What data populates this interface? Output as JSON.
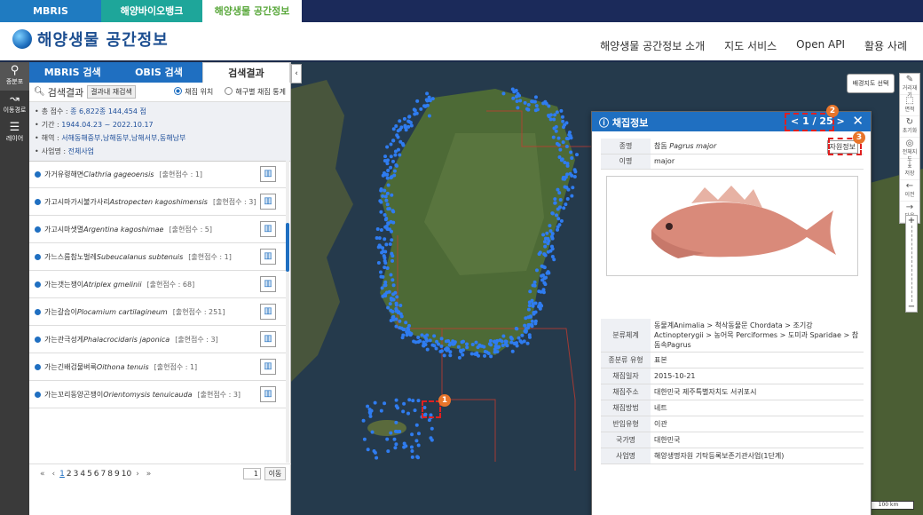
{
  "topnav": {
    "tabs": [
      "MBRIS",
      "해양바이오뱅크",
      "해양생물 공간정보"
    ]
  },
  "header": {
    "logo_text": "해양생물 공간정보",
    "nav": [
      "해양생물 공간정보 소개",
      "지도 서비스",
      "Open API",
      "활용 사례"
    ]
  },
  "rail": {
    "items": [
      {
        "label": "종분포",
        "icon": "map-pin-icon"
      },
      {
        "label": "이동경로",
        "icon": "route-icon"
      },
      {
        "label": "레이어",
        "icon": "layers-icon"
      }
    ]
  },
  "panel": {
    "tabs": [
      "MBRIS 검색",
      "OBIS 검색",
      "검색결과"
    ],
    "search_label": "검색결과",
    "research_button": "결과내 재검색",
    "radio_1": "채집 위치",
    "radio_2": "해구별 채집 통계",
    "summary": {
      "total_k": "총 점수 : ",
      "total_v": "종 6,822종 144,454 점",
      "period_k": "기간 : ",
      "period_v": "1944.04.23 ~ 2022.10.17",
      "area_k": "해역 : ",
      "area_v": "서해동해중부,남해동부,남해서부,동해남부",
      "project_k": "사업명 : ",
      "project_v": "전체사업"
    },
    "results": [
      {
        "ko": "가거유령해면",
        "sci": "Clathria gageoensis",
        "count": "[출현점수 : 1]"
      },
      {
        "ko": "가고시마가시불가사리",
        "sci": "Astropecten kagoshimensis",
        "count": "[출현점수 : 3]"
      },
      {
        "ko": "가고시마샛멸",
        "sci": "Argentina kagoshimae",
        "count": "[출현점수 : 5]"
      },
      {
        "ko": "가느스름참노벌레",
        "sci": "Subeucalanus subtenuis",
        "count": "[출현점수 : 1]"
      },
      {
        "ko": "가는갯는쟁이",
        "sci": "Atriplex gmelinii",
        "count": "[출현점수 : 68]"
      },
      {
        "ko": "가는갈습이",
        "sci": "Plocamium cartilagineum",
        "count": "[출현점수 : 251]"
      },
      {
        "ko": "가는관극성게",
        "sci": "Phalacrocidaris japonica",
        "count": "[출현점수 : 3]"
      },
      {
        "ko": "가는긴배검물벼룩",
        "sci": "Oithona tenuis",
        "count": "[출현점수 : 1]"
      },
      {
        "ko": "가는꼬리동양곤쟁이",
        "sci": "Orientomysis tenuicauda",
        "count": "[출현점수 : 3]"
      }
    ],
    "pager": {
      "first": "«",
      "prev": "‹",
      "pages": [
        "1",
        "2",
        "3",
        "4",
        "5",
        "6",
        "7",
        "8",
        "9",
        "10"
      ],
      "next": "›",
      "last": "»",
      "input": "1",
      "go": "이동"
    }
  },
  "map": {
    "bg_select": "배경지도 선택",
    "tools": [
      {
        "icon": "pencil-icon",
        "label": "거리재기"
      },
      {
        "icon": "area-icon",
        "label": "면적"
      },
      {
        "icon": "refresh-icon",
        "label": "초기화"
      },
      {
        "icon": "globe-icon",
        "label": "전체지도"
      },
      {
        "icon": "save-icon",
        "label": "저장"
      },
      {
        "icon": "arrow-left-icon",
        "label": "이전"
      },
      {
        "icon": "arrow-right-icon",
        "label": "다음"
      }
    ],
    "zoom_in": "+",
    "zoom_out": "−",
    "scale": "100 km",
    "markers": [
      "1",
      "2",
      "3"
    ]
  },
  "popup": {
    "title": "채집정보",
    "nav_prev": "<",
    "nav_text": "1 / 25",
    "nav_next": ">",
    "close": "✕",
    "species_k": "종명",
    "species_ko": "참돔 ",
    "species_sci": "Pagrus major",
    "alias_k": "이명",
    "alias_v": "major",
    "resource_button": "자원정보",
    "details": [
      {
        "k": "분류체계",
        "v": "동물계Animalia > 척삭동물문 Chordata > 조기강Actinopterygii > 농어목 Perciformes > 도미과 Sparidae > 참돔속Pagrus"
      },
      {
        "k": "종분류 유형",
        "v": "표본"
      },
      {
        "k": "채집일자",
        "v": "2015-10-21"
      },
      {
        "k": "채집주소",
        "v": "대한민국 제주특별자치도 서귀포시"
      },
      {
        "k": "채집방법",
        "v": "네트"
      },
      {
        "k": "반입유형",
        "v": "이관"
      },
      {
        "k": "국가명",
        "v": "대한민국"
      },
      {
        "k": "사업명",
        "v": "해양생명자원 기탁등록보존기관사업(1단계)"
      }
    ]
  }
}
